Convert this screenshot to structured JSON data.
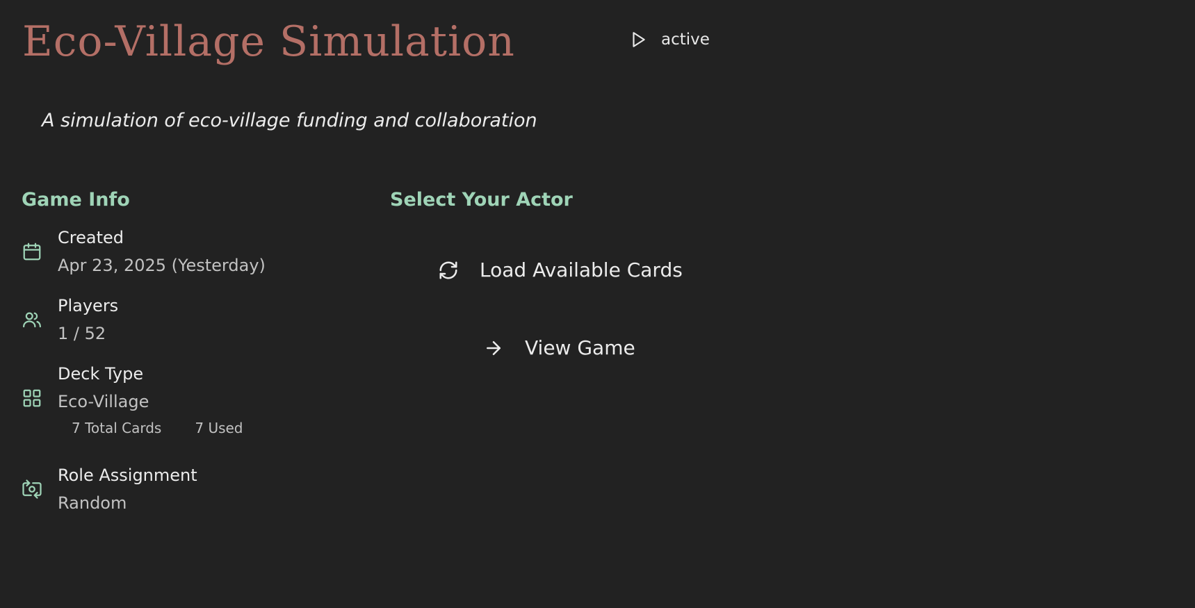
{
  "header": {
    "title": "Eco-Village Simulation",
    "status": "active",
    "status_icon": "play-icon"
  },
  "subtitle": "A simulation of eco-village funding and collaboration",
  "game_info": {
    "heading": "Game Info",
    "created": {
      "label": "Created",
      "value": "Apr 23, 2025 (Yesterday)",
      "icon": "calendar-icon"
    },
    "players": {
      "label": "Players",
      "value": "1 / 52",
      "icon": "users-icon"
    },
    "deck": {
      "label": "Deck Type",
      "value": "Eco-Village",
      "total_cards": "7 Total Cards",
      "used": "7 Used",
      "icon": "grid-icon"
    },
    "role": {
      "label": "Role Assignment",
      "value": "Random",
      "icon": "switch-camera-icon"
    }
  },
  "actor": {
    "heading": "Select Your Actor",
    "load_button": "Load Available Cards",
    "load_icon": "refresh-icon",
    "view_button": "View Game",
    "view_icon": "arrow-right-icon"
  },
  "colors": {
    "background": "#222222",
    "title": "#b46f66",
    "accent": "#9fd4b7",
    "text": "#ececec",
    "muted": "#c2c2c2"
  }
}
